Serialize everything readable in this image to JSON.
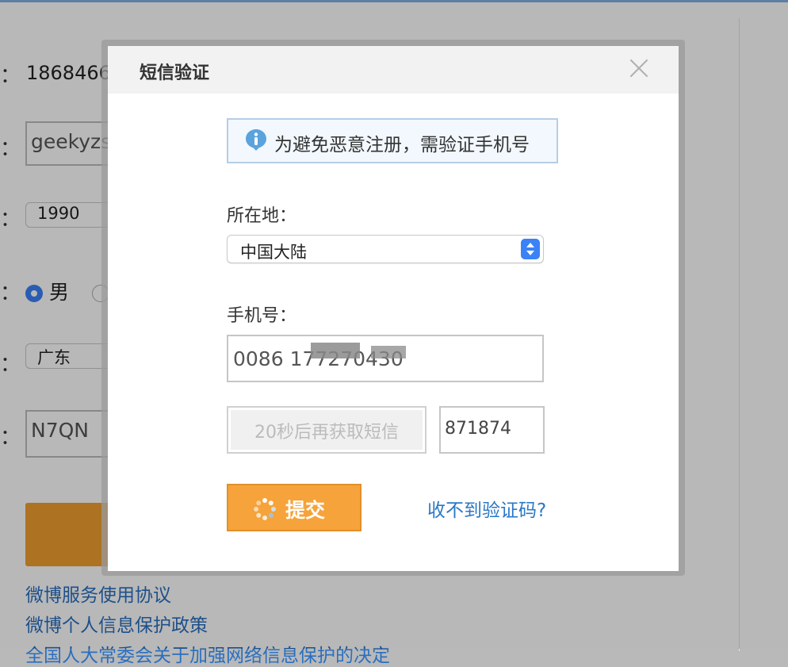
{
  "background_form": {
    "phone_value": "1868466",
    "nickname_value": "geekyzs",
    "birth_year": "1990",
    "gender_selected": "男",
    "province": "广东",
    "captcha_value": "N7QN",
    "links": [
      "微博服务使用协议",
      "微博个人信息保护政策",
      "全国人大常委会关于加强网络信息保护的决定"
    ]
  },
  "modal": {
    "title": "短信验证",
    "notice": "为避免恶意注册，需验证手机号",
    "location_label": "所在地：",
    "location_value": "中国大陆",
    "phone_label": "手机号：",
    "phone_value": "0086 177270430",
    "resend_label": "20秒后再获取短信",
    "code_value": "871874",
    "submit_label": "提交",
    "help_link": "收不到验证码?"
  },
  "colors": {
    "accent_orange": "#f5a33a",
    "link_blue": "#2a78c5",
    "select_blue": "#3b82f6",
    "notice_border": "#b6cde6"
  },
  "icons": [
    "close-icon",
    "info-icon",
    "spinner-icon",
    "select-arrows-icon"
  ]
}
